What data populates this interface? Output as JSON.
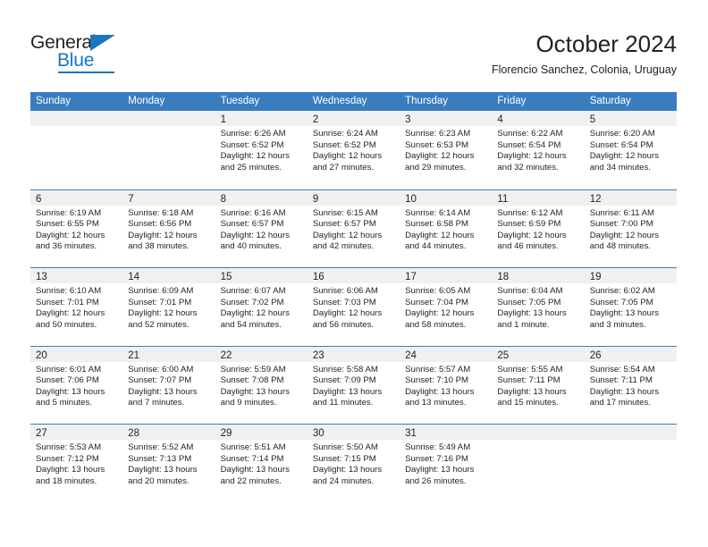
{
  "brand": {
    "name_part1": "General",
    "name_part2": "Blue"
  },
  "header": {
    "title": "October 2024",
    "subtitle": "Florencio Sanchez, Colonia, Uruguay"
  },
  "colors": {
    "header_blue": "#3a7dbf",
    "brand_blue": "#1b76bc",
    "daynum_band": "#f0f0f0",
    "text": "#231f20"
  },
  "weekdays": [
    "Sunday",
    "Monday",
    "Tuesday",
    "Wednesday",
    "Thursday",
    "Friday",
    "Saturday"
  ],
  "weeks": [
    [
      {
        "day": "",
        "sunrise": "",
        "sunset": "",
        "daylight1": "",
        "daylight2": ""
      },
      {
        "day": "",
        "sunrise": "",
        "sunset": "",
        "daylight1": "",
        "daylight2": ""
      },
      {
        "day": "1",
        "sunrise": "Sunrise: 6:26 AM",
        "sunset": "Sunset: 6:52 PM",
        "daylight1": "Daylight: 12 hours",
        "daylight2": "and 25 minutes."
      },
      {
        "day": "2",
        "sunrise": "Sunrise: 6:24 AM",
        "sunset": "Sunset: 6:52 PM",
        "daylight1": "Daylight: 12 hours",
        "daylight2": "and 27 minutes."
      },
      {
        "day": "3",
        "sunrise": "Sunrise: 6:23 AM",
        "sunset": "Sunset: 6:53 PM",
        "daylight1": "Daylight: 12 hours",
        "daylight2": "and 29 minutes."
      },
      {
        "day": "4",
        "sunrise": "Sunrise: 6:22 AM",
        "sunset": "Sunset: 6:54 PM",
        "daylight1": "Daylight: 12 hours",
        "daylight2": "and 32 minutes."
      },
      {
        "day": "5",
        "sunrise": "Sunrise: 6:20 AM",
        "sunset": "Sunset: 6:54 PM",
        "daylight1": "Daylight: 12 hours",
        "daylight2": "and 34 minutes."
      }
    ],
    [
      {
        "day": "6",
        "sunrise": "Sunrise: 6:19 AM",
        "sunset": "Sunset: 6:55 PM",
        "daylight1": "Daylight: 12 hours",
        "daylight2": "and 36 minutes."
      },
      {
        "day": "7",
        "sunrise": "Sunrise: 6:18 AM",
        "sunset": "Sunset: 6:56 PM",
        "daylight1": "Daylight: 12 hours",
        "daylight2": "and 38 minutes."
      },
      {
        "day": "8",
        "sunrise": "Sunrise: 6:16 AM",
        "sunset": "Sunset: 6:57 PM",
        "daylight1": "Daylight: 12 hours",
        "daylight2": "and 40 minutes."
      },
      {
        "day": "9",
        "sunrise": "Sunrise: 6:15 AM",
        "sunset": "Sunset: 6:57 PM",
        "daylight1": "Daylight: 12 hours",
        "daylight2": "and 42 minutes."
      },
      {
        "day": "10",
        "sunrise": "Sunrise: 6:14 AM",
        "sunset": "Sunset: 6:58 PM",
        "daylight1": "Daylight: 12 hours",
        "daylight2": "and 44 minutes."
      },
      {
        "day": "11",
        "sunrise": "Sunrise: 6:12 AM",
        "sunset": "Sunset: 6:59 PM",
        "daylight1": "Daylight: 12 hours",
        "daylight2": "and 46 minutes."
      },
      {
        "day": "12",
        "sunrise": "Sunrise: 6:11 AM",
        "sunset": "Sunset: 7:00 PM",
        "daylight1": "Daylight: 12 hours",
        "daylight2": "and 48 minutes."
      }
    ],
    [
      {
        "day": "13",
        "sunrise": "Sunrise: 6:10 AM",
        "sunset": "Sunset: 7:01 PM",
        "daylight1": "Daylight: 12 hours",
        "daylight2": "and 50 minutes."
      },
      {
        "day": "14",
        "sunrise": "Sunrise: 6:09 AM",
        "sunset": "Sunset: 7:01 PM",
        "daylight1": "Daylight: 12 hours",
        "daylight2": "and 52 minutes."
      },
      {
        "day": "15",
        "sunrise": "Sunrise: 6:07 AM",
        "sunset": "Sunset: 7:02 PM",
        "daylight1": "Daylight: 12 hours",
        "daylight2": "and 54 minutes."
      },
      {
        "day": "16",
        "sunrise": "Sunrise: 6:06 AM",
        "sunset": "Sunset: 7:03 PM",
        "daylight1": "Daylight: 12 hours",
        "daylight2": "and 56 minutes."
      },
      {
        "day": "17",
        "sunrise": "Sunrise: 6:05 AM",
        "sunset": "Sunset: 7:04 PM",
        "daylight1": "Daylight: 12 hours",
        "daylight2": "and 58 minutes."
      },
      {
        "day": "18",
        "sunrise": "Sunrise: 6:04 AM",
        "sunset": "Sunset: 7:05 PM",
        "daylight1": "Daylight: 13 hours",
        "daylight2": "and 1 minute."
      },
      {
        "day": "19",
        "sunrise": "Sunrise: 6:02 AM",
        "sunset": "Sunset: 7:05 PM",
        "daylight1": "Daylight: 13 hours",
        "daylight2": "and 3 minutes."
      }
    ],
    [
      {
        "day": "20",
        "sunrise": "Sunrise: 6:01 AM",
        "sunset": "Sunset: 7:06 PM",
        "daylight1": "Daylight: 13 hours",
        "daylight2": "and 5 minutes."
      },
      {
        "day": "21",
        "sunrise": "Sunrise: 6:00 AM",
        "sunset": "Sunset: 7:07 PM",
        "daylight1": "Daylight: 13 hours",
        "daylight2": "and 7 minutes."
      },
      {
        "day": "22",
        "sunrise": "Sunrise: 5:59 AM",
        "sunset": "Sunset: 7:08 PM",
        "daylight1": "Daylight: 13 hours",
        "daylight2": "and 9 minutes."
      },
      {
        "day": "23",
        "sunrise": "Sunrise: 5:58 AM",
        "sunset": "Sunset: 7:09 PM",
        "daylight1": "Daylight: 13 hours",
        "daylight2": "and 11 minutes."
      },
      {
        "day": "24",
        "sunrise": "Sunrise: 5:57 AM",
        "sunset": "Sunset: 7:10 PM",
        "daylight1": "Daylight: 13 hours",
        "daylight2": "and 13 minutes."
      },
      {
        "day": "25",
        "sunrise": "Sunrise: 5:55 AM",
        "sunset": "Sunset: 7:11 PM",
        "daylight1": "Daylight: 13 hours",
        "daylight2": "and 15 minutes."
      },
      {
        "day": "26",
        "sunrise": "Sunrise: 5:54 AM",
        "sunset": "Sunset: 7:11 PM",
        "daylight1": "Daylight: 13 hours",
        "daylight2": "and 17 minutes."
      }
    ],
    [
      {
        "day": "27",
        "sunrise": "Sunrise: 5:53 AM",
        "sunset": "Sunset: 7:12 PM",
        "daylight1": "Daylight: 13 hours",
        "daylight2": "and 18 minutes."
      },
      {
        "day": "28",
        "sunrise": "Sunrise: 5:52 AM",
        "sunset": "Sunset: 7:13 PM",
        "daylight1": "Daylight: 13 hours",
        "daylight2": "and 20 minutes."
      },
      {
        "day": "29",
        "sunrise": "Sunrise: 5:51 AM",
        "sunset": "Sunset: 7:14 PM",
        "daylight1": "Daylight: 13 hours",
        "daylight2": "and 22 minutes."
      },
      {
        "day": "30",
        "sunrise": "Sunrise: 5:50 AM",
        "sunset": "Sunset: 7:15 PM",
        "daylight1": "Daylight: 13 hours",
        "daylight2": "and 24 minutes."
      },
      {
        "day": "31",
        "sunrise": "Sunrise: 5:49 AM",
        "sunset": "Sunset: 7:16 PM",
        "daylight1": "Daylight: 13 hours",
        "daylight2": "and 26 minutes."
      },
      {
        "day": "",
        "sunrise": "",
        "sunset": "",
        "daylight1": "",
        "daylight2": ""
      },
      {
        "day": "",
        "sunrise": "",
        "sunset": "",
        "daylight1": "",
        "daylight2": ""
      }
    ]
  ]
}
